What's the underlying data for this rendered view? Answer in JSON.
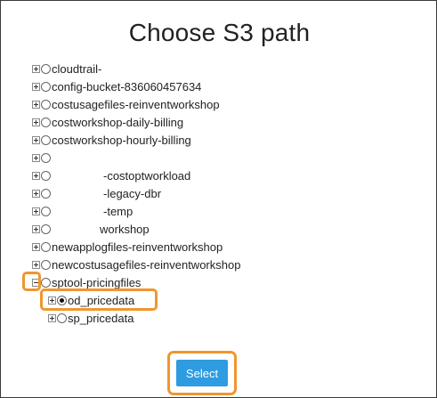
{
  "dialog": {
    "title": "Choose S3 path"
  },
  "tree": {
    "items": [
      {
        "label": "cloudtrail-",
        "pad": 0
      },
      {
        "label": "config-bucket-836060457634",
        "pad": 0
      },
      {
        "label": "costusagefiles-reinventworkshop",
        "pad": 0
      },
      {
        "label": "costworkshop-daily-billing",
        "pad": 0
      },
      {
        "label": "costworkshop-hourly-billing",
        "pad": 0
      },
      {
        "label": "",
        "pad": 0
      },
      {
        "label": "-costoptworkload",
        "pad": 58
      },
      {
        "label": "-legacy-dbr",
        "pad": 58
      },
      {
        "label": "-temp",
        "pad": 58
      },
      {
        "label": "workshop",
        "pad": 54
      },
      {
        "label": "newapplogfiles-reinventworkshop",
        "pad": 0
      },
      {
        "label": "newcostusagefiles-reinventworkshop",
        "pad": 0
      },
      {
        "label": "sptool-pricingfiles",
        "pad": 0,
        "expanded": true
      },
      {
        "label": "od_pricedata",
        "pad": 0,
        "child": true,
        "selected": true
      },
      {
        "label": "sp_pricedata",
        "pad": 0,
        "child": true
      }
    ]
  },
  "actions": {
    "select_label": "Select"
  },
  "colors": {
    "highlight": "#f0962f",
    "button": "#2f9be0"
  }
}
